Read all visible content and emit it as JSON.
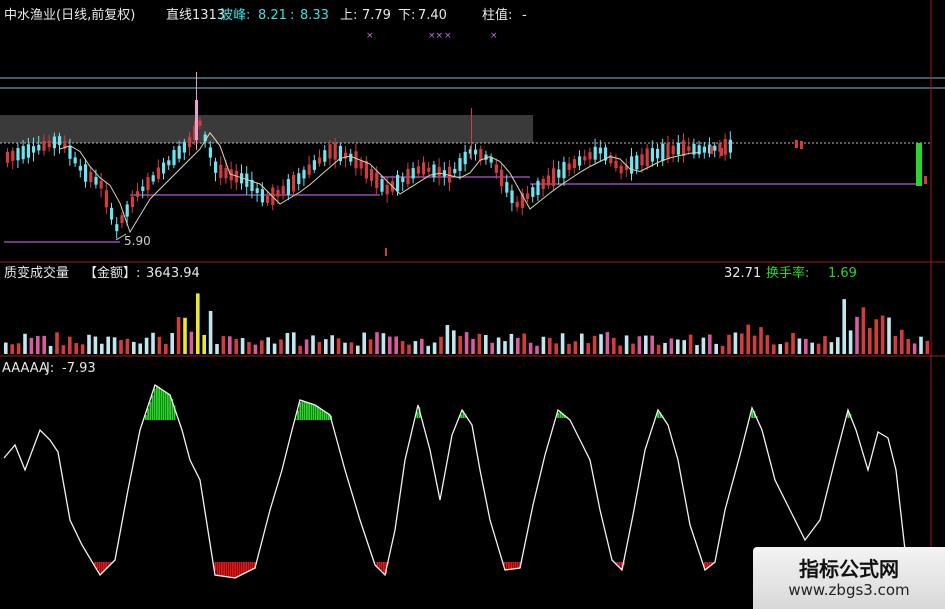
{
  "main_header": {
    "stock_title": "中水渔业(日线,前复权)",
    "line_label": "直线1313",
    "wave_label": "波峰:",
    "wave_value1": "8.21",
    "wave_sep": ":",
    "wave_value2": "8.33",
    "upper_label": "上:",
    "upper_value": "7.79",
    "lower_label": "下:",
    "lower_value": "7.40",
    "column_label": "柱值:",
    "column_value": "-"
  },
  "price_annotation": "5.90",
  "volume_header": {
    "title": "质变成交量",
    "amount_label": "【金额】:",
    "amount_value": "3643.94",
    "value_partial": "32.71",
    "turnover_label": "换手率:",
    "turnover_value": "1.69"
  },
  "indicator_header": {
    "name": "AAAAA",
    "j_label": "J:",
    "j_value": "-7.93"
  },
  "watermark": {
    "title": "指标公式网",
    "url": "www.zbgs3.com"
  },
  "colors": {
    "up": "#d23c3c",
    "down": "#6fe3f0",
    "ma": "#d8d8b0",
    "purple": "#b05ad0",
    "green": "#2ad62a",
    "red_fill": "#e01818",
    "yellow": "#e8e830",
    "magenta": "#e06ee0"
  }
}
